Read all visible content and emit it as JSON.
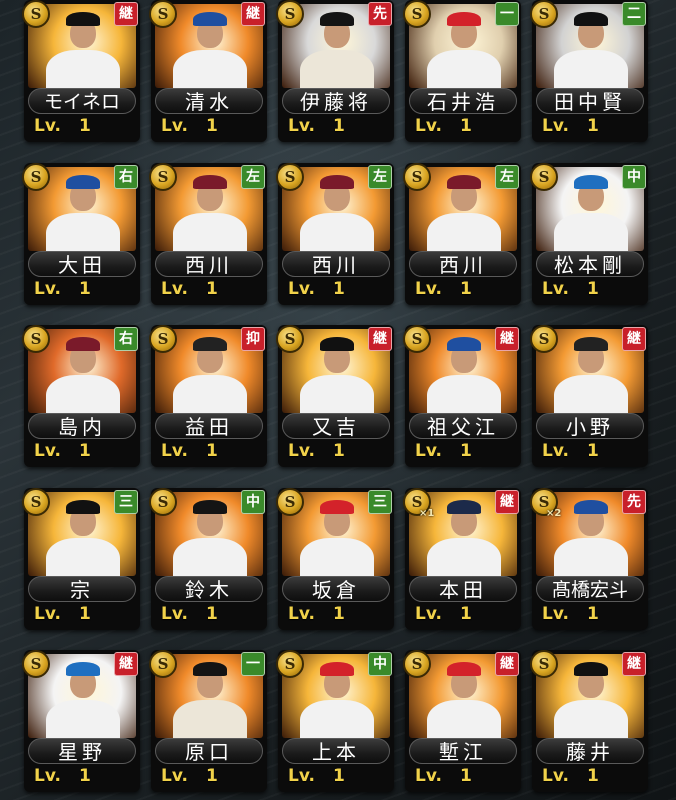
{
  "rarity_symbol": "S",
  "level_prefix": "Lv.",
  "colors": {
    "relief": "#c8202a",
    "starter": "#c8202a",
    "fielder": "#3a8a2a",
    "level_text": "#f1d24a",
    "badge_gold": "#d9a521"
  },
  "cards": [
    {
      "name": "モイネロ",
      "position": "継",
      "level": "1",
      "pos_color": "#c8202a",
      "glow": "#f6b63a",
      "cap": "#111111",
      "uniform": "#f2f2f2"
    },
    {
      "name": "清水",
      "position": "継",
      "level": "1",
      "pos_color": "#c8202a",
      "glow": "#f08a2a",
      "cap": "#1f4fa0",
      "uniform": "#f2f2f2"
    },
    {
      "name": "伊藤将",
      "position": "先",
      "level": "1",
      "pos_color": "#c8202a",
      "glow": "#d9d9d9",
      "cap": "#141414",
      "uniform": "#ece6d8"
    },
    {
      "name": "石井浩",
      "position": "一",
      "level": "1",
      "pos_color": "#3a8a2a",
      "glow": "#e0cfae",
      "cap": "#d3222a",
      "uniform": "#f2f2f2"
    },
    {
      "name": "田中賢",
      "position": "二",
      "level": "1",
      "pos_color": "#3a8a2a",
      "glow": "#d2d2d2",
      "cap": "#111111",
      "uniform": "#f2f2f2"
    },
    {
      "name": "大田",
      "position": "右",
      "level": "1",
      "pos_color": "#3a8a2a",
      "glow": "#f39a33",
      "cap": "#1f4fa0",
      "uniform": "#f2f2f2"
    },
    {
      "name": "西川",
      "position": "左",
      "level": "1",
      "pos_color": "#3a8a2a",
      "glow": "#f39a33",
      "cap": "#7a1a2a",
      "uniform": "#f2f2f2"
    },
    {
      "name": "西川",
      "position": "左",
      "level": "1",
      "pos_color": "#3a8a2a",
      "glow": "#f39a33",
      "cap": "#7a1a2a",
      "uniform": "#f2f2f2"
    },
    {
      "name": "西川",
      "position": "左",
      "level": "1",
      "pos_color": "#3a8a2a",
      "glow": "#f39a33",
      "cap": "#7a1a2a",
      "uniform": "#f2f2f2"
    },
    {
      "name": "松本剛",
      "position": "中",
      "level": "1",
      "pos_color": "#3a8a2a",
      "glow": "#f4f4f4",
      "cap": "#1f6fc0",
      "uniform": "#f2f2f2"
    },
    {
      "name": "島内",
      "position": "右",
      "level": "1",
      "pos_color": "#3a8a2a",
      "glow": "#e06a2a",
      "cap": "#7a1a2a",
      "uniform": "#f2f2f2"
    },
    {
      "name": "益田",
      "position": "抑",
      "level": "1",
      "pos_color": "#c8202a",
      "glow": "#f08a2a",
      "cap": "#222222",
      "uniform": "#f2f2f2"
    },
    {
      "name": "又吉",
      "position": "継",
      "level": "1",
      "pos_color": "#c8202a",
      "glow": "#f6b63a",
      "cap": "#111111",
      "uniform": "#f2f2f2"
    },
    {
      "name": "祖父江",
      "position": "継",
      "level": "1",
      "pos_color": "#c8202a",
      "glow": "#f08a2a",
      "cap": "#1f4fa0",
      "uniform": "#f2f2f2"
    },
    {
      "name": "小野",
      "position": "継",
      "level": "1",
      "pos_color": "#c8202a",
      "glow": "#f39a33",
      "cap": "#222222",
      "uniform": "#f2f2f2"
    },
    {
      "name": "宗",
      "position": "三",
      "level": "1",
      "pos_color": "#3a8a2a",
      "glow": "#f6b63a",
      "cap": "#111111",
      "uniform": "#f2f2f2"
    },
    {
      "name": "鈴木",
      "position": "中",
      "level": "1",
      "pos_color": "#3a8a2a",
      "glow": "#f08a2a",
      "cap": "#141414",
      "uniform": "#f2f2f2"
    },
    {
      "name": "坂倉",
      "position": "三",
      "level": "1",
      "pos_color": "#3a8a2a",
      "glow": "#f39a33",
      "cap": "#d3222a",
      "uniform": "#f2f2f2"
    },
    {
      "name": "本田",
      "position": "継",
      "level": "1",
      "pos_color": "#c8202a",
      "glow": "#f6b63a",
      "cap": "#1c2a4a",
      "uniform": "#f2f2f2",
      "rank": "×1"
    },
    {
      "name": "髙橋宏斗",
      "position": "先",
      "level": "1",
      "pos_color": "#c8202a",
      "glow": "#f08a2a",
      "cap": "#1f4fa0",
      "uniform": "#f2f2f2",
      "rank": "×2"
    },
    {
      "name": "星野",
      "position": "継",
      "level": "1",
      "pos_color": "#c8202a",
      "glow": "#f4f4f4",
      "cap": "#1f6fc0",
      "uniform": "#f2f2f2"
    },
    {
      "name": "原口",
      "position": "一",
      "level": "1",
      "pos_color": "#3a8a2a",
      "glow": "#f08a2a",
      "cap": "#141414",
      "uniform": "#ece6d8"
    },
    {
      "name": "上本",
      "position": "中",
      "level": "1",
      "pos_color": "#3a8a2a",
      "glow": "#f6b63a",
      "cap": "#d3222a",
      "uniform": "#f2f2f2"
    },
    {
      "name": "塹江",
      "position": "継",
      "level": "1",
      "pos_color": "#c8202a",
      "glow": "#f39a33",
      "cap": "#d3222a",
      "uniform": "#f2f2f2"
    },
    {
      "name": "藤井",
      "position": "継",
      "level": "1",
      "pos_color": "#c8202a",
      "glow": "#f6b63a",
      "cap": "#111111",
      "uniform": "#f2f2f2"
    }
  ]
}
